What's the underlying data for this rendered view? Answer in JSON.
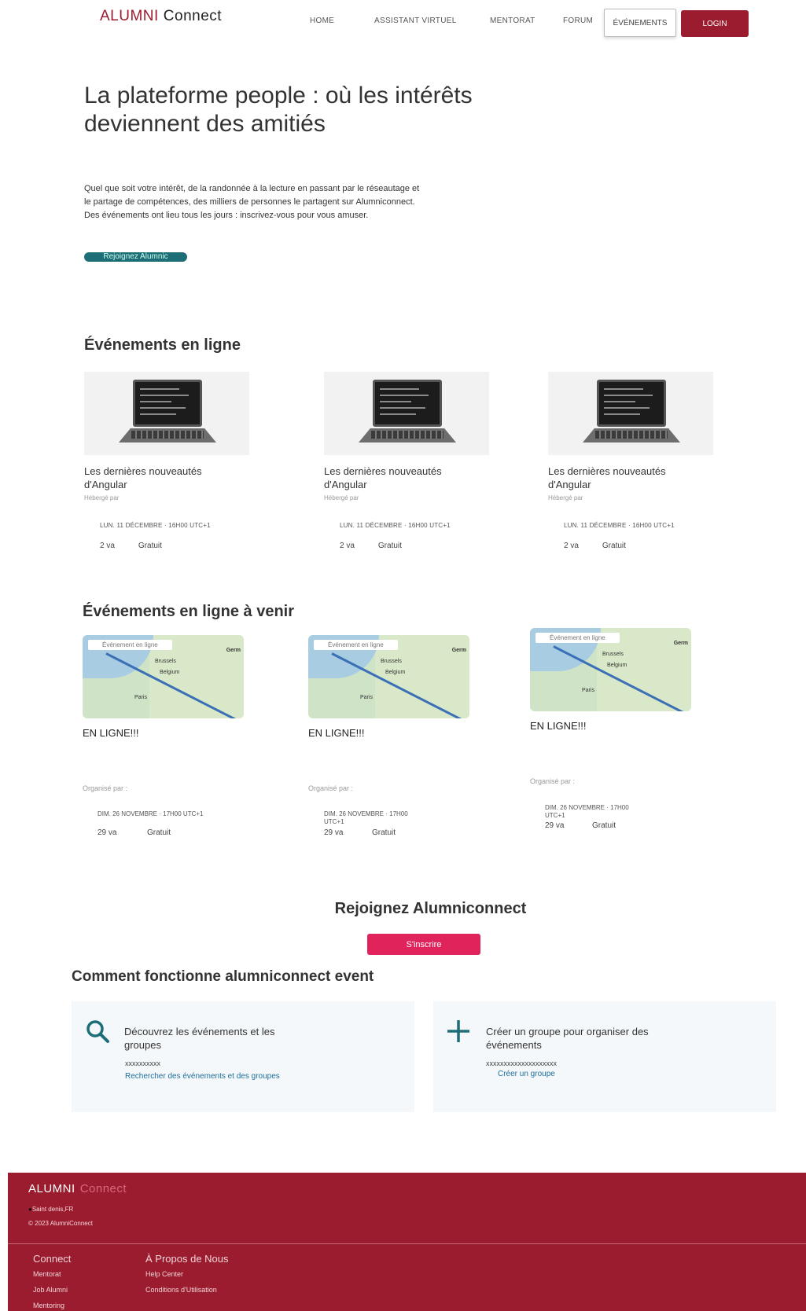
{
  "nav": {
    "brand_part1": "ALUMNI",
    "brand_part2": "Connect",
    "home": "HOME",
    "assistant": "ASSISTANT VIRTUEL",
    "mentorat": "MENTORAT",
    "forum": "FORUM",
    "events": "ÉVÉNEMENTS",
    "login": "LOGIN"
  },
  "hero": {
    "title": "La plateforme people : où les intérêts deviennent des amitiés",
    "description_lines": [
      "Quel que soit votre intérêt, de la randonnée à la lecture en passant par le réseautage et",
      "le partage de compétences, des milliers de personnes le partagent sur Alumniconnect.",
      "Des événements ont lieu tous les jours : inscrivez-vous pour vous amuser."
    ],
    "cta": "Rejoignez Alumnic"
  },
  "online_events": {
    "title": "Événements en ligne",
    "items": [
      {
        "title": "Les dernières nouveautés d'Angular",
        "hosted": "Hébergé par",
        "date": "LUN. 11 DÉCEMBRE · 16H00 UTC+1",
        "going": "2 va",
        "price": "Gratuit"
      },
      {
        "title": "Les dernières nouveautés d'Angular",
        "hosted": "Hébergé par",
        "date": "LUN. 11 DÉCEMBRE · 16H00 UTC+1",
        "going": "2 va",
        "price": "Gratuit"
      },
      {
        "title": "Les dernières nouveautés d'Angular",
        "hosted": "Hébergé par",
        "date": "LUN. 11 DÉCEMBRE · 16H00 UTC+1",
        "going": "2 va",
        "price": "Gratuit"
      }
    ]
  },
  "upcoming_events": {
    "title": "Événements en ligne à venir",
    "items": [
      {
        "tag": "Événement en ligne",
        "title": "EN LIGNE!!!",
        "organizer": "Organisé par :",
        "date_line1": "DIM. 26 NOVEMBRE · 17H00 UTC+1",
        "date_line2": "",
        "going": "29 va",
        "price": "Gratuit"
      },
      {
        "tag": "Événement en ligne",
        "title": "EN LIGNE!!!",
        "organizer": "Organisé par :",
        "date_line1": "DIM. 26 NOVEMBRE · 17H00",
        "date_line2": "UTC+1",
        "going": "29 va",
        "price": "Gratuit"
      },
      {
        "tag": "Événement en ligne",
        "title": "EN LIGNE!!!",
        "organizer": "Organisé par :",
        "date_line1": "DIM. 26 NOVEMBRE · 17H00",
        "date_line2": "UTC+1",
        "going": "29 va",
        "price": "Gratuit"
      }
    ],
    "map_places": [
      "Germ",
      "Belgium",
      "Brussels",
      "Paris"
    ]
  },
  "join": {
    "title": "Rejoignez Alumniconnect",
    "button": "S'inscrire"
  },
  "how": {
    "title": "Comment fonctionne alumniconnect event",
    "cards": [
      {
        "heading_line1": "Découvrez les événements et les",
        "heading_line2": "groupes",
        "placeholder": "xxxxxxxxxx",
        "link": "Rechercher des événements et des groupes",
        "icon": "search-icon"
      },
      {
        "heading_line1": "Créer un groupe pour organiser des",
        "heading_line2": "événements",
        "placeholder": "xxxxxxxxxxxxxxxxxxxx",
        "link": "Créer un groupe",
        "icon": "plus-icon"
      }
    ]
  },
  "footer": {
    "brand_part1": "ALUMNI",
    "brand_part2": "Connect",
    "location": "Saint denis,FR",
    "copyright": "© 2023 AlumniConnect",
    "col1_title": "Connect",
    "col1_links": [
      "Mentorat",
      "Job Alumni",
      "Mentoring"
    ],
    "col2_title": "À Propos de Nous",
    "col2_links": [
      "Help Center",
      "Conditions d'Utilisation"
    ]
  },
  "colors": {
    "brand": "#9b1c2e",
    "teal": "#1e6e78",
    "pink": "#e0245b"
  }
}
